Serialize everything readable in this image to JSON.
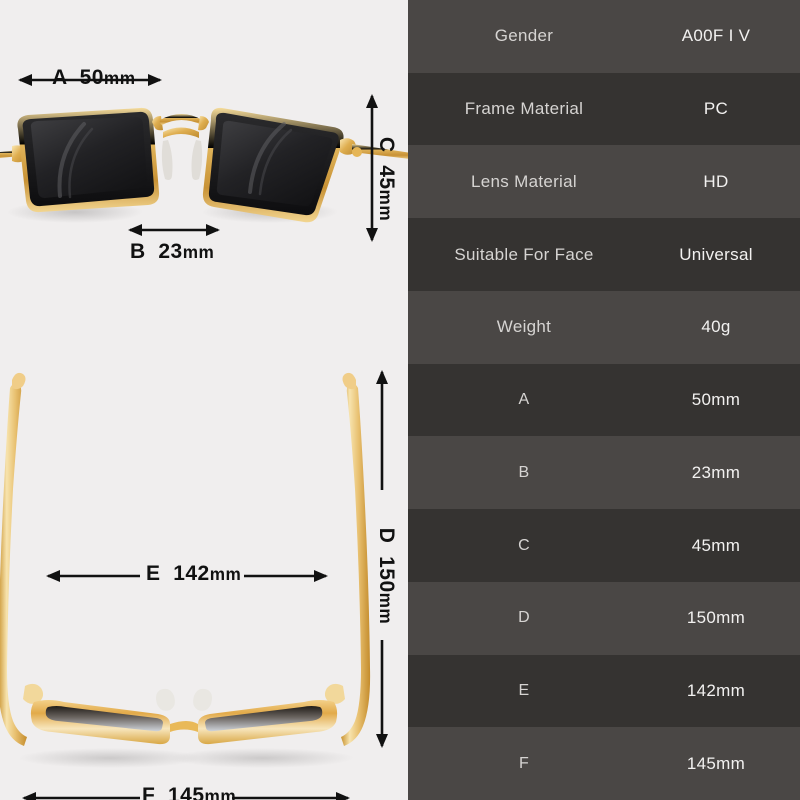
{
  "product_diagram": {
    "front_view": {
      "alt": "front view of gold-framed square sunglasses with dark lenses",
      "measurements": [
        {
          "code": "A",
          "value": "50",
          "unit": "mm",
          "orientation": "horizontal",
          "position": "top"
        },
        {
          "code": "B",
          "value": "23",
          "unit": "mm",
          "orientation": "horizontal",
          "position": "bottom"
        },
        {
          "code": "C",
          "value": "45",
          "unit": "mm",
          "orientation": "vertical",
          "position": "right"
        }
      ]
    },
    "folded_view": {
      "alt": "top-down view of folded sunglasses with temples extended",
      "measurements": [
        {
          "code": "E",
          "value": "142",
          "unit": "mm",
          "orientation": "horizontal",
          "position": "middle"
        },
        {
          "code": "F",
          "value": "145",
          "unit": "mm",
          "orientation": "horizontal",
          "position": "bottom"
        },
        {
          "code": "D",
          "value": "150",
          "unit": "mm",
          "orientation": "vertical",
          "position": "right"
        }
      ]
    }
  },
  "spec_table": {
    "rows": [
      {
        "key": "Gender",
        "value": "A00F I V"
      },
      {
        "key": "Frame Material",
        "value": "PC"
      },
      {
        "key": "Lens Material",
        "value": "HD"
      },
      {
        "key": "Suitable For Face",
        "value": "Universal"
      },
      {
        "key": "Weight",
        "value": "40g"
      },
      {
        "key": "A",
        "value": "50mm"
      },
      {
        "key": "B",
        "value": "23mm"
      },
      {
        "key": "C",
        "value": "45mm"
      },
      {
        "key": "D",
        "value": "150mm"
      },
      {
        "key": "E",
        "value": "142mm"
      },
      {
        "key": "F",
        "value": "145mm"
      }
    ]
  },
  "colors": {
    "left_background": "#f0eeee",
    "row_light": "#4a4745",
    "row_dark": "#353331",
    "key_text": "#d6d4d2",
    "value_text": "#f2f1f0",
    "dimension_text": "#111111",
    "frame_gold": "#e8bb5c",
    "lens_dark": "#2a2a2c"
  }
}
